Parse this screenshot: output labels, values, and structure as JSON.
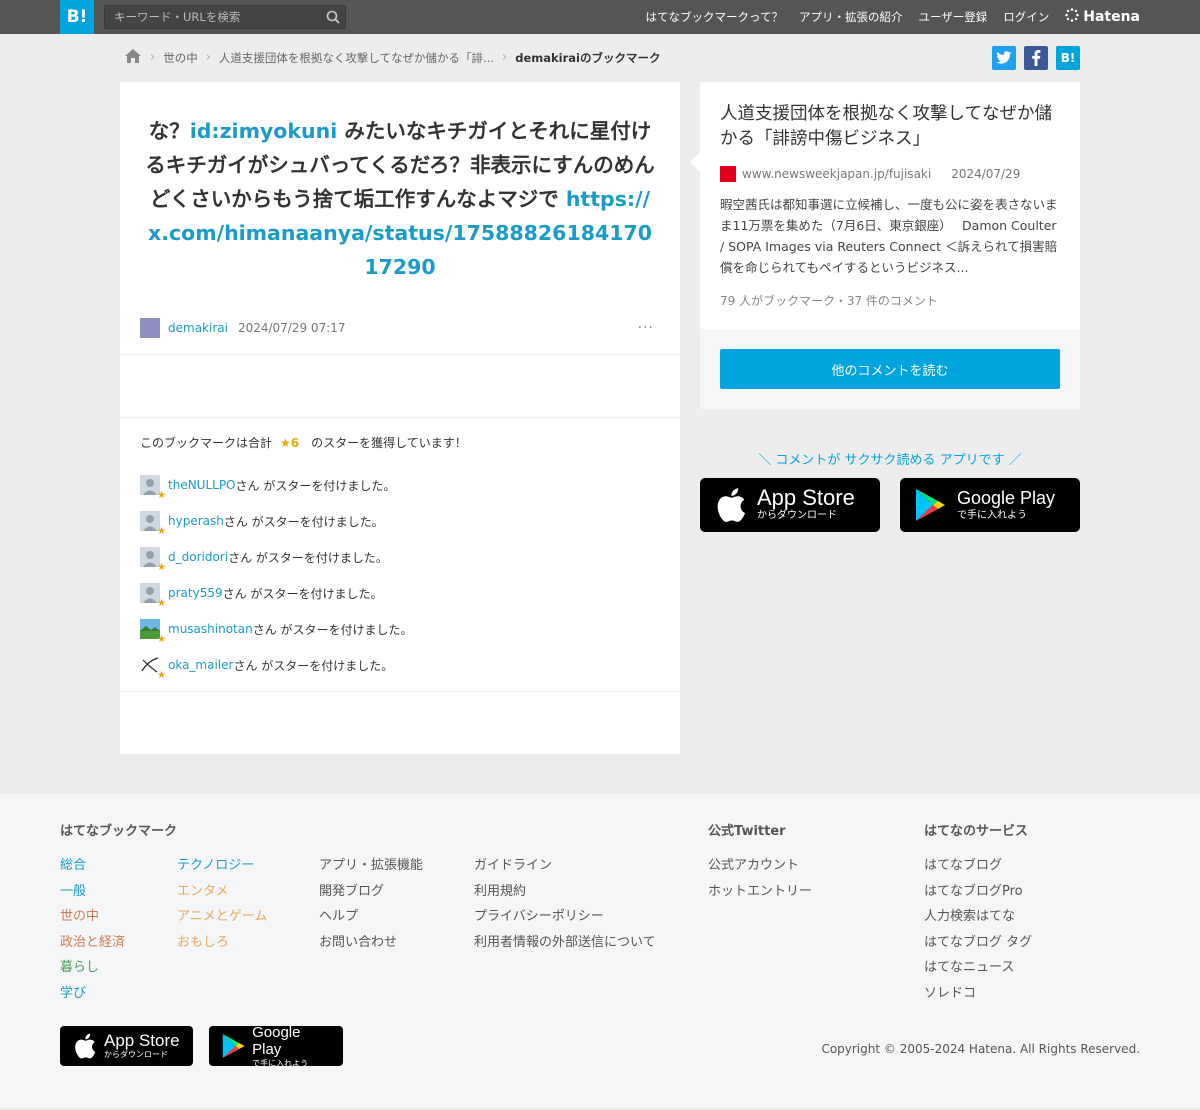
{
  "header": {
    "logo": "B!",
    "search_placeholder": "キーワード・URLを検索",
    "nav": [
      "はてなブックマークって？",
      "アプリ・拡張の紹介",
      "ユーザー登録",
      "ログイン"
    ],
    "brand": "Hatena"
  },
  "breadcrumb": {
    "items": [
      "世の中",
      "人道支援団体を根拠なく攻撃してなぜか儲かる「誹...",
      "demakiraiのブックマーク"
    ]
  },
  "share": {
    "hatena_label": "B!"
  },
  "bookmark": {
    "text_before": "な？",
    "id_link": "id:zimyokuni",
    "text_after": " みたいなキチガイとそれに星付けるキチガイがシュバってくるだろ？非表示にすんのめんどくさいからもう捨て垢工作すんなよマジで ",
    "url": "https://x.com/himanaanya/status/1758882618417017290",
    "user": "demakirai",
    "time": "2024/07/29 07:17",
    "more": "···"
  },
  "stars": {
    "title_before": "このブックマークは合計",
    "count": "★6",
    "title_after": "のスターを獲得しています！",
    "suffix": "さん がスターを付けました。",
    "users": [
      "theNULLPO",
      "hyperash",
      "d_doridori",
      "praty559",
      "musashinotan",
      "oka_mailer"
    ]
  },
  "entry": {
    "title": "人道支援団体を根拠なく攻撃してなぜか儲かる「誹謗中傷ビジネス」",
    "domain": "www.newsweekjapan.jp/fujisaki",
    "date": "2024/07/29",
    "summary": "暇空茜氏は都知事選に立候補し、一度も公に姿を表さないまま11万票を集めた（7月6日、東京銀座）　 Damon Coulter / SOPA Images via Reuters Connect ＜訴えられて損害賠償を命じられてもペイするというビジネス...",
    "count": "79 人がブックマーク・37 件のコメント",
    "read_more": "他のコメントを読む"
  },
  "promo": {
    "text": "＼ コメントが サクサク読める アプリです ／",
    "appstore_big": "App Store",
    "appstore_small": "からダウンロード",
    "googleplay_big": "Google Play",
    "googleplay_small": "で手に入れよう"
  },
  "footer": {
    "col1_title": "はてなブックマーク",
    "categories1": [
      "総合",
      "一般",
      "世の中",
      "政治と経済",
      "暮らし",
      "学び"
    ],
    "categories2": [
      "テクノロジー",
      "エンタメ",
      "アニメとゲーム",
      "おもしろ"
    ],
    "links1": [
      "アプリ・拡張機能",
      "開発ブログ",
      "ヘルプ",
      "お問い合わせ"
    ],
    "links2": [
      "ガイドライン",
      "利用規約",
      "プライバシーポリシー",
      "利用者情報の外部送信について"
    ],
    "twitter_title": "公式Twitter",
    "twitter_links": [
      "公式アカウント",
      "ホットエントリー"
    ],
    "services_title": "はてなのサービス",
    "services": [
      "はてなブログ",
      "はてなブログPro",
      "人力検索はてな",
      "はてなブログ タグ",
      "はてなニュース",
      "ソレドコ"
    ],
    "copyright": "Copyright © 2005-2024 Hatena. All Rights Reserved."
  },
  "colors": {
    "accent": "#00a4de",
    "link": "#1a9bc9",
    "star": "#e8a900",
    "topbar": "#555555"
  }
}
